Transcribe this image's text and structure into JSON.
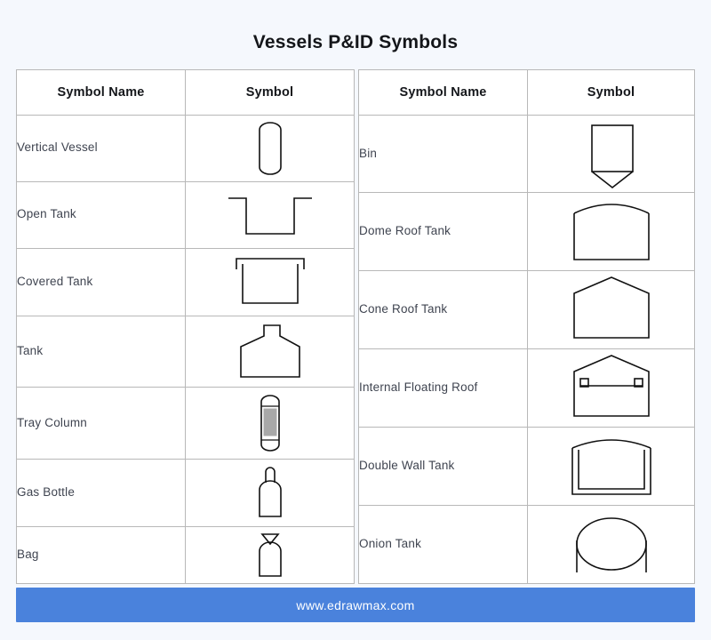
{
  "title": "Vessels P&ID Symbols",
  "colors": {
    "background": "#f5f8fd",
    "footer_banner": "#4a82dc",
    "table_border": "#b8b8b8",
    "symbol_stroke": "#111111",
    "text": "#3f4450",
    "heading": "#14161a"
  },
  "tables": [
    {
      "id": "left-table",
      "headers": [
        "Symbol Name",
        "Symbol"
      ],
      "rows": [
        {
          "name": "Vertical Vessel",
          "symbol": "vertical-vessel-symbol"
        },
        {
          "name": "Open Tank",
          "symbol": "open-tank-symbol"
        },
        {
          "name": "Covered Tank",
          "symbol": "covered-tank-symbol"
        },
        {
          "name": "Tank",
          "symbol": "tank-symbol"
        },
        {
          "name": "Tray Column",
          "symbol": "tray-column-symbol"
        },
        {
          "name": "Gas Bottle",
          "symbol": "gas-bottle-symbol"
        },
        {
          "name": "Bag",
          "symbol": "bag-symbol"
        }
      ]
    },
    {
      "id": "right-table",
      "headers": [
        "Symbol Name",
        "Symbol"
      ],
      "rows": [
        {
          "name": "Bin",
          "symbol": "bin-symbol"
        },
        {
          "name": "Dome Roof Tank",
          "symbol": "dome-roof-tank-symbol"
        },
        {
          "name": "Cone Roof Tank",
          "symbol": "cone-roof-tank-symbol"
        },
        {
          "name": "Internal Floating Roof",
          "symbol": "internal-floating-roof-symbol"
        },
        {
          "name": "Double Wall Tank",
          "symbol": "double-wall-tank-symbol"
        },
        {
          "name": "Onion Tank",
          "symbol": "onion-tank-symbol"
        }
      ]
    }
  ],
  "footer": {
    "url": "www.edrawmax.com"
  }
}
